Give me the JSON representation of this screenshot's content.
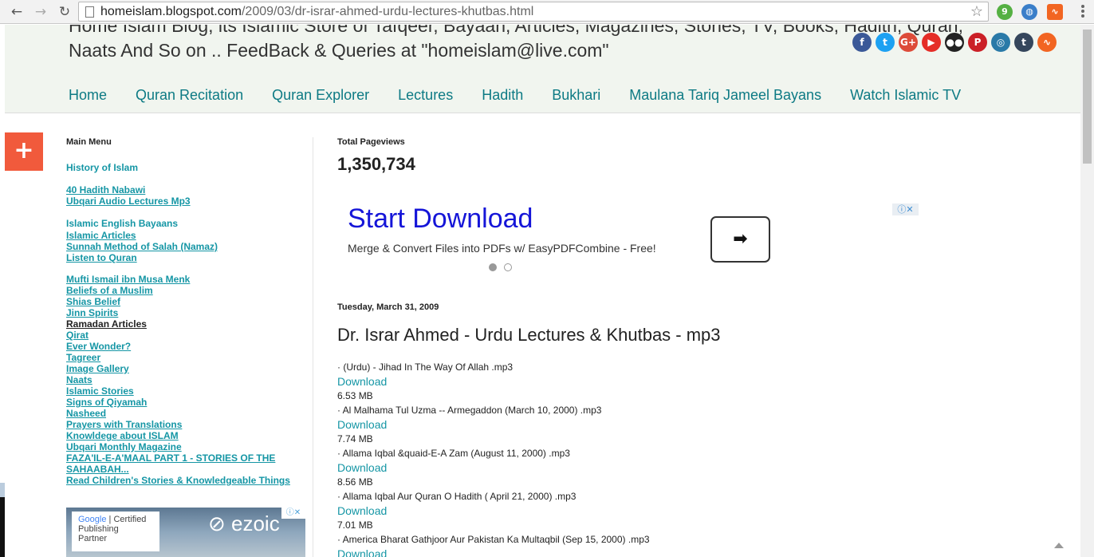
{
  "browser": {
    "url_host": "homeislam.blogspot.com",
    "url_path": "/2009/03/dr-israr-ahmed-urdu-lectures-khutbas.html",
    "back_glyph": "←",
    "forward_glyph": "→",
    "reload_glyph": "↻",
    "star_glyph": "☆",
    "extensions": [
      {
        "name": "evernote-icon",
        "glyph": "9",
        "color": "#55b043"
      },
      {
        "name": "globe-icon",
        "glyph": "◍",
        "color": "#3a7ec9"
      },
      {
        "name": "rss-icon",
        "glyph": "∿",
        "color": "#f26522"
      }
    ]
  },
  "header": {
    "tagline_line1": "Home Islam Blog, its Islamic Store of Tafqeer, Bayaan, Articles, Magazines, Stories, TV, Books, Hadith, Quran,",
    "tagline_line2": "Naats And So on .. FeedBack & Queries at \"homeislam@live.com\"",
    "social": [
      {
        "name": "facebook-icon",
        "glyph": "f",
        "color": "#3b5998"
      },
      {
        "name": "twitter-icon",
        "glyph": "t",
        "color": "#1da1f2"
      },
      {
        "name": "google-plus-icon",
        "glyph": "G+",
        "color": "#dd4b39"
      },
      {
        "name": "youtube-icon",
        "glyph": "▶",
        "color": "#e52d27"
      },
      {
        "name": "flickr-icon",
        "glyph": "●●",
        "color": "#222222"
      },
      {
        "name": "pinterest-icon",
        "glyph": "P",
        "color": "#cb2027"
      },
      {
        "name": "instagram-icon",
        "glyph": "◎",
        "color": "#2a7aa8"
      },
      {
        "name": "tumblr-icon",
        "glyph": "t",
        "color": "#35465c"
      },
      {
        "name": "rss-feed-icon",
        "glyph": "∿",
        "color": "#f26522"
      }
    ],
    "nav": [
      "Home",
      "Quran Recitation",
      "Quran Explorer",
      "Lectures",
      "Hadith",
      "Bukhari",
      "Maulana Tariq Jameel Bayans",
      "Watch Islamic TV"
    ]
  },
  "share": {
    "glyph": "+"
  },
  "sidebar": {
    "title": "Main Menu",
    "groups": [
      [
        {
          "label": "History of Islam",
          "u": false
        }
      ],
      [
        {
          "label": "40 Hadith Nabawi",
          "u": true
        },
        {
          "label": "Ubqari Audio Lectures Mp3",
          "u": true
        }
      ],
      [
        {
          "label": "Islamic English Bayaans",
          "u": false
        },
        {
          "label": "Islamic Articles",
          "u": true
        },
        {
          "label": "Sunnah Method of Salah (Namaz)",
          "u": true
        },
        {
          "label": "Listen to Quran",
          "u": true
        }
      ],
      [
        {
          "label": "Mufti Ismail ibn Musa Menk",
          "u": true
        },
        {
          "label": "Beliefs of a Muslim",
          "u": true
        },
        {
          "label": "Shias Belief",
          "u": true
        },
        {
          "label": "Jinn Spirits",
          "u": true
        },
        {
          "label": "Ramadan Articles",
          "u": true,
          "black": true
        },
        {
          "label": "Qirat",
          "u": true
        },
        {
          "label": "Ever Wonder?",
          "u": true
        },
        {
          "label": "Tagreer",
          "u": true
        },
        {
          "label": "Image Gallery",
          "u": true
        },
        {
          "label": "Naats",
          "u": true
        },
        {
          "label": "Islamic Stories",
          "u": true
        },
        {
          "label": "Signs of Qiyamah",
          "u": true
        },
        {
          "label": "Nasheed",
          "u": true
        },
        {
          "label": "Prayers with Translations",
          "u": true
        },
        {
          "label": "Knowldege about ISLAM",
          "u": true
        },
        {
          "label": "Ubqari Monthly Magazine",
          "u": true
        },
        {
          "label": "FAZA'IL-E-A'MAAL PART 1 - STORIES OF THE",
          "u": true
        },
        {
          "label": "SAHAABAH...",
          "u": true
        },
        {
          "label": "Read Children's Stories & Knowledgeable Things",
          "u": true
        }
      ]
    ],
    "ad": {
      "google": "Google",
      "certified": "Certified",
      "publishing": "Publishing",
      "partner": "Partner",
      "ezoic": "⊘ ezoic",
      "close": "ⓘ✕"
    }
  },
  "main": {
    "pageviews_title": "Total Pageviews",
    "pageviews_count": "1,350,734",
    "ad": {
      "headline": "Start Download",
      "sub": "Merge & Convert Files into PDFs w/ EasyPDFCombine - Free!",
      "arrow": "➡",
      "adchoice": "ⓘ✕"
    },
    "post_date": "Tuesday, March 31, 2009",
    "post_title": "Dr. Israr Ahmed - Urdu Lectures & Khutbas - mp3",
    "download_label": "Download",
    "tracks": [
      {
        "name": "· (Urdu) - Jihad In The Way Of Allah .mp3",
        "size": "6.53 MB"
      },
      {
        "name": "· Al Malhama Tul Uzma -- Armegaddon (March 10, 2000) .mp3",
        "size": "7.74 MB"
      },
      {
        "name": "· Allama Iqbal &quaid-E-A Zam (August 11, 2000) .mp3",
        "size": "8.56 MB"
      },
      {
        "name": "· Allama Iqbal Aur Quran O Hadith ( April 21, 2000) .mp3",
        "size": "7.01 MB"
      },
      {
        "name": "· America Bharat Gathjoor Aur Pakistan Ka Multaqbil (Sep 15, 2000) .mp3",
        "size": ""
      }
    ]
  }
}
